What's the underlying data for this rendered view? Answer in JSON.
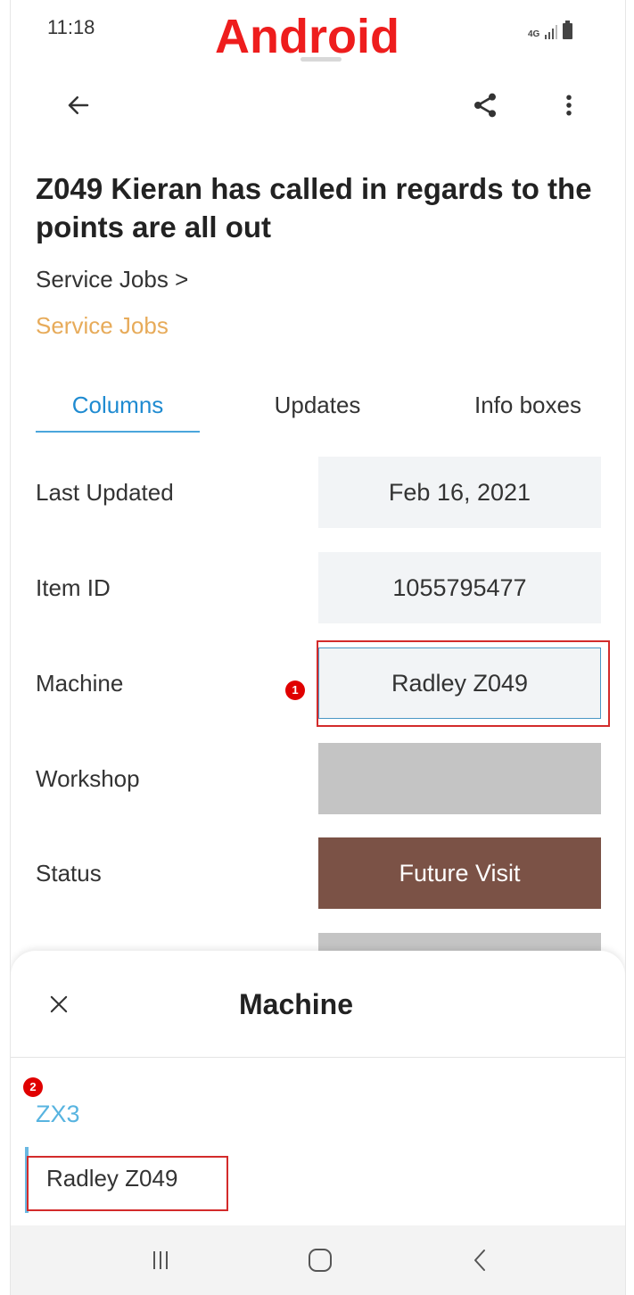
{
  "status_bar": {
    "time": "11:18",
    "network": "4G",
    "overlay_label": "Android",
    "overlay_color": "#ee1d1d"
  },
  "app_bar": {
    "back_icon": "arrow-left-icon",
    "share_icon": "share-icon",
    "more_icon": "more-vertical-icon"
  },
  "item": {
    "title": "Z049  Kieran has called in regards to the points are all out",
    "breadcrumb": "Service Jobs >",
    "board": "Service Jobs",
    "board_color": "#e7ab5a"
  },
  "tabs": [
    {
      "label": "Columns",
      "active": true
    },
    {
      "label": "Updates",
      "active": false
    },
    {
      "label": "Info boxes",
      "active": false
    }
  ],
  "columns": [
    {
      "label": "Last Updated",
      "value": "Feb 16, 2021"
    },
    {
      "label": "Item ID",
      "value": "1055795477"
    },
    {
      "label": "Machine",
      "value": "Radley Z049"
    },
    {
      "label": "Workshop",
      "value": ""
    },
    {
      "label": "Status",
      "value": "Future Visit",
      "color": "#7b5246"
    }
  ],
  "annotations": {
    "marker_1": "1",
    "marker_2": "2",
    "color": "#d32b2b"
  },
  "sheet": {
    "close_icon": "close-icon",
    "title": "Machine",
    "group_name": "ZX3",
    "option": "Radley Z049"
  },
  "nav_bar": {
    "recents_icon": "recents-icon",
    "home_icon": "home-icon",
    "back_icon": "back-chevron-icon"
  }
}
